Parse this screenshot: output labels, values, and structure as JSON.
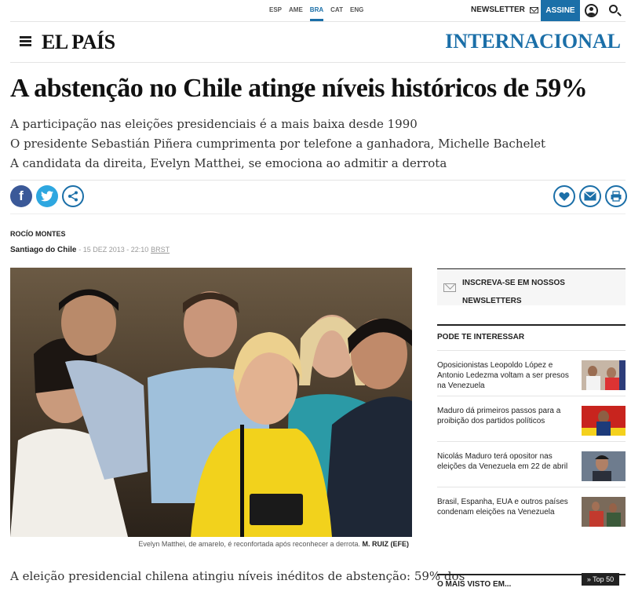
{
  "topbar": {
    "editions": [
      "ESP",
      "AME",
      "BRA",
      "CAT",
      "ENG"
    ],
    "active_edition": "BRA",
    "newsletter_label": "NEWSLETTER",
    "subscribe_label": "ASSINE"
  },
  "header": {
    "logo": "EL PAÍS",
    "section": "INTERNACIONAL"
  },
  "article": {
    "headline": "A abstenção no Chile atinge níveis históricos de 59%",
    "subtitles": [
      "A participação nas eleições presidenciais é a mais baixa desde 1990",
      "O presidente Sebastián Piñera cumprimenta por telefone a ganhadora, Michelle Bachelet",
      "A candidata da direita, Evelyn Matthei, se emociona ao admitir a derrota"
    ],
    "author": "ROCÍO MONTES",
    "place": "Santiago do Chile",
    "date": "15 DEZ 2013 - 22:10",
    "timezone": "BRST",
    "caption": "Evelyn Matthei, de amarelo, é reconfortada após reconhecer a derrota.",
    "photo_credit": "M. RUIZ (EFE)",
    "body_start": "A eleição presidencial chilena atingiu níveis inéditos de abstenção: 59% dos"
  },
  "social": {
    "facebook_glyph": "f"
  },
  "sidebar": {
    "newsletter_line1": "INSCREVA-SE EM NOSSOS",
    "newsletter_line2": "NEWSLETTERS",
    "related_title": "PODE TE INTERESSAR",
    "related": [
      {
        "title": "Oposicionistas Leopoldo López e Antonio Ledezma voltam a ser presos na Venezuela"
      },
      {
        "title": "Maduro dá primeiros passos para a proibição dos partidos políticos"
      },
      {
        "title": "Nicolás Maduro terá opositor nas eleições da Venezuela em 22 de abril"
      },
      {
        "title": "Brasil, Espanha, EUA e outros países condenam eleições na Venezuela"
      }
    ],
    "most_viewed_title": "O MAIS VISTO EM...",
    "top50_label": "» Top 50"
  },
  "colors": {
    "brand_blue": "#1b6fa8",
    "facebook": "#3b5998",
    "twitter": "#2ea7e0"
  }
}
